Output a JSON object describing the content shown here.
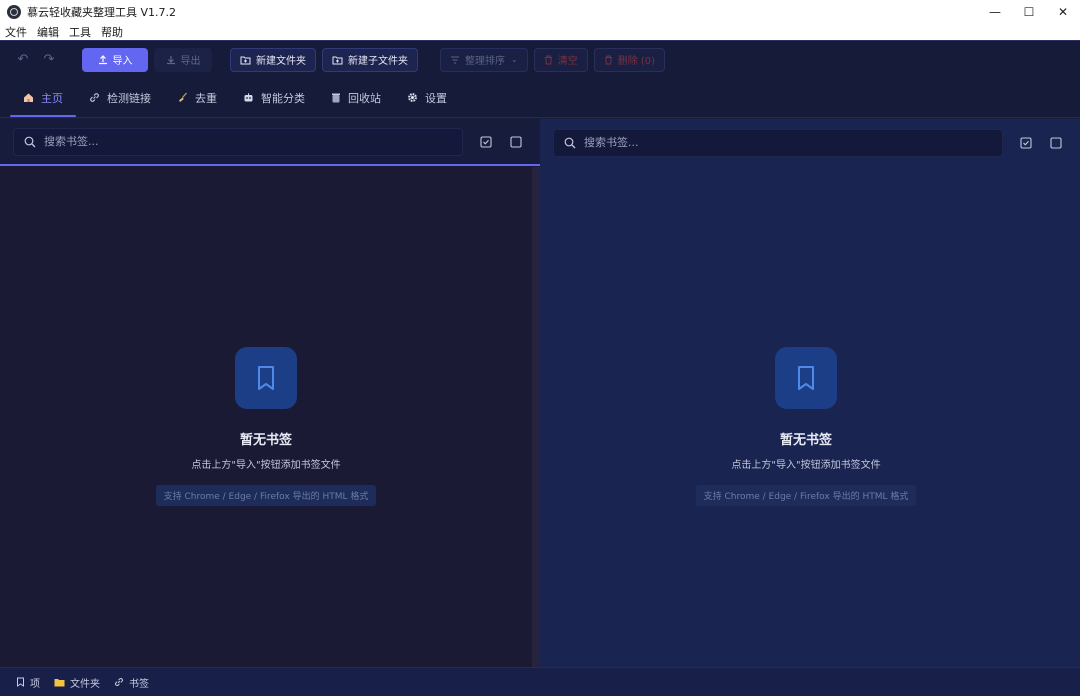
{
  "window": {
    "title": "慕云轻收藏夹整理工具 V1.7.2",
    "minimize": "—",
    "maximize": "☐",
    "close": "✕"
  },
  "menu": {
    "items": [
      {
        "label": "文件"
      },
      {
        "label": "编辑"
      },
      {
        "label": "工具"
      },
      {
        "label": "帮助"
      }
    ]
  },
  "toolbar": {
    "undo_icon": "↶",
    "redo_icon": "↷",
    "import_label": "导入",
    "export_label": "导出",
    "new_folder_label": "新建文件夹",
    "new_subfolder_label": "新建子文件夹",
    "sort_label": "整理排序",
    "clear_label": "清空",
    "delete_label": "删除 (0)"
  },
  "tabs": [
    {
      "label": "主页",
      "icon": "home-icon"
    },
    {
      "label": "检测链接",
      "icon": "link-icon"
    },
    {
      "label": "去重",
      "icon": "broom-icon"
    },
    {
      "label": "智能分类",
      "icon": "robot-icon"
    },
    {
      "label": "回收站",
      "icon": "trash-icon"
    },
    {
      "label": "设置",
      "icon": "gear-icon"
    }
  ],
  "left_panel": {
    "search_placeholder": "搜索书签...",
    "empty_title": "暂无书签",
    "empty_subtitle": "点击上方\"导入\"按钮添加书签文件",
    "empty_hint": "支持 Chrome / Edge / Firefox 导出的 HTML 格式"
  },
  "right_panel": {
    "search_placeholder": "搜索书签...",
    "empty_title": "暂无书签",
    "empty_subtitle": "点击上方\"导入\"按钮添加书签文件",
    "empty_hint": "支持 Chrome / Edge / Firefox 导出的 HTML 格式"
  },
  "status": {
    "items_label": "项",
    "folders_label": "文件夹",
    "bookmarks_label": "书签"
  },
  "colors": {
    "accent": "#6366f1",
    "background_left": "#1b1a35",
    "background_right": "#1a2450"
  }
}
